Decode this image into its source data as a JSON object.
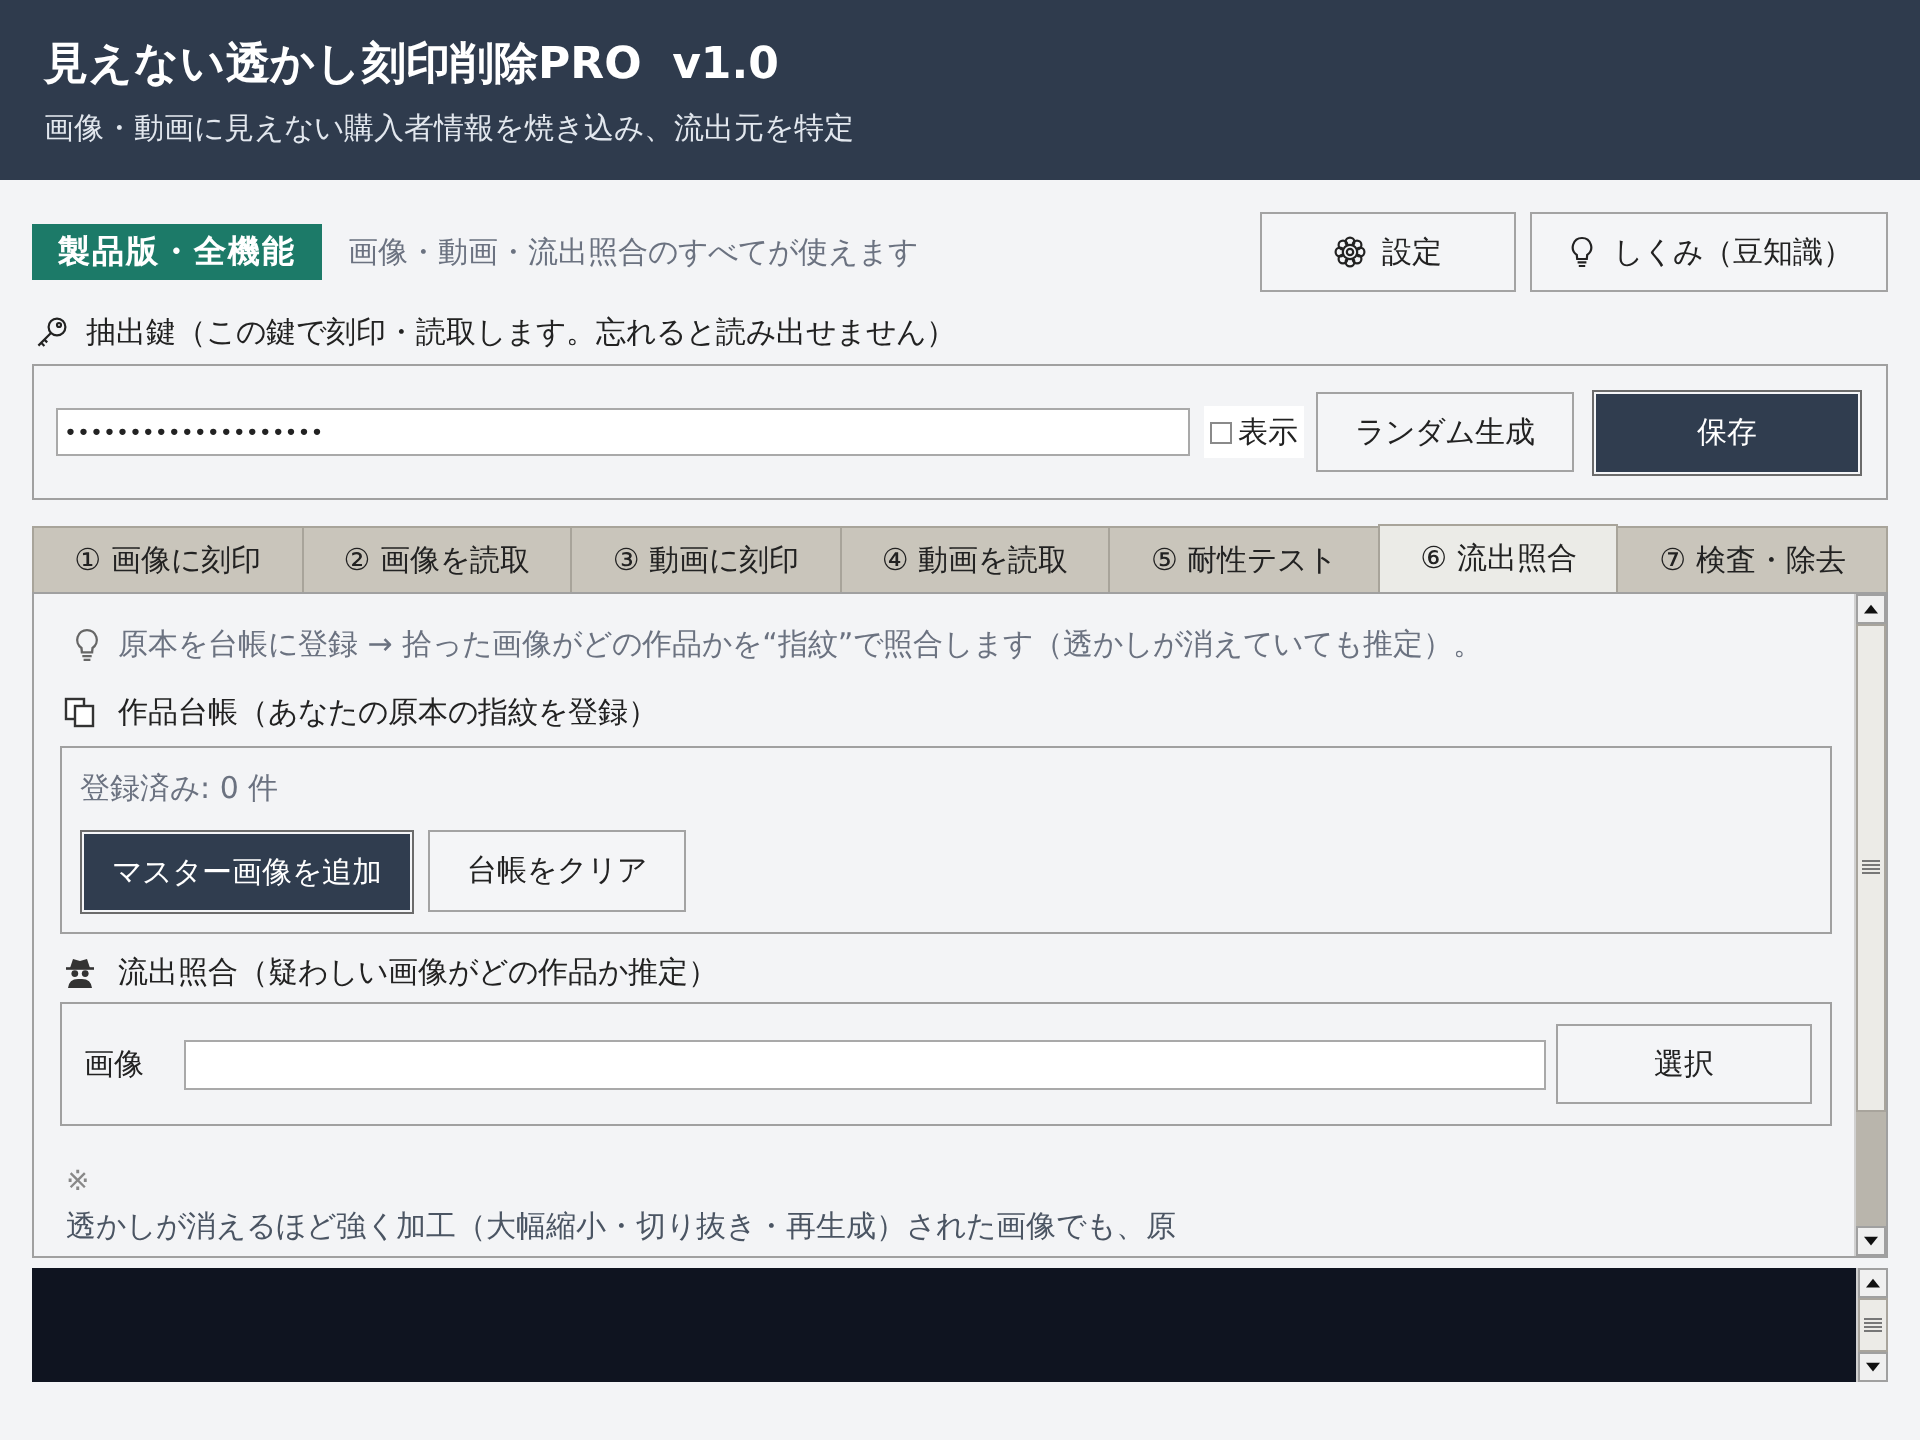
{
  "header": {
    "title": "見えない透かし刻印削除PRO  v1.0",
    "subtitle": "画像・動画に見えない購入者情報を焼き込み、流出元を特定"
  },
  "license": {
    "badge": "製品版・全機能",
    "note": "画像・動画・流出照合のすべてが使えます"
  },
  "settings_button": {
    "label": "設定"
  },
  "tips_button": {
    "label": "しくみ（豆知識）"
  },
  "key": {
    "label": "抽出鍵（この鍵で刻印・読取します。忘れると読み出せません）",
    "value": "••••••••••••••••••••",
    "show": {
      "label": "表示",
      "checked": false
    },
    "buttons": [
      {
        "label": "ランダム生成",
        "primary": false
      },
      {
        "label": "保存",
        "primary": true
      }
    ]
  },
  "tabs": [
    {
      "label": "① 画像に刻印",
      "selected": false
    },
    {
      "label": "② 画像を読取",
      "selected": false
    },
    {
      "label": "③ 動画に刻印",
      "selected": false
    },
    {
      "label": "④ 動画を読取",
      "selected": false
    },
    {
      "label": "⑤ 耐性テスト",
      "selected": false
    },
    {
      "label": "⑥ 流出照合",
      "selected": true
    },
    {
      "label": "⑦ 検査・除去",
      "selected": false
    }
  ],
  "panel": {
    "hint": "原本を台帳に登録 → 拾った画像がどの作品かを“指紋”で照合します（透かしが消えていても推定）。",
    "ledger": {
      "heading": "作品台帳（あなたの原本の指紋を登録）",
      "count": "登録済み: 0 件",
      "buttons": [
        {
          "label": "マスター画像を追加",
          "primary": true
        },
        {
          "label": "台帳をクリア",
          "primary": false
        }
      ]
    },
    "match": {
      "heading": "流出照合（疑わしい画像がどの作品か推定）",
      "field_label": "画像",
      "button": "選択"
    },
    "note": {
      "mark": "※",
      "text": "透かしが消えるほど強く加工（大幅縮小・切り抜き・再生成）された画像でも、原"
    }
  }
}
